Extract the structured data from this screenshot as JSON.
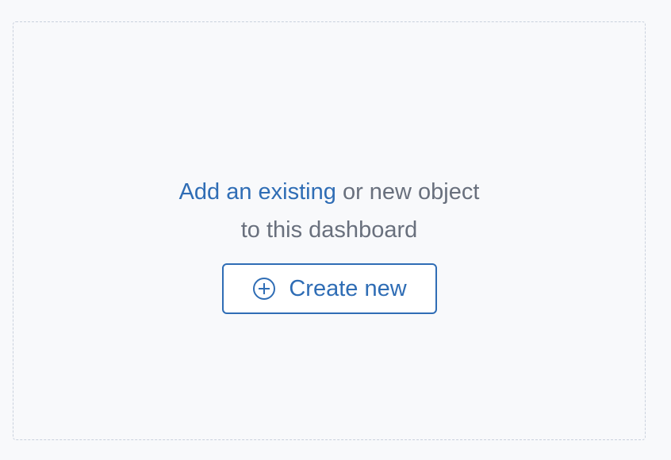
{
  "empty_state": {
    "link_text": "Add an existing",
    "text_rest": "or new object",
    "text_line2": "to this dashboard",
    "create_button_label": "Create new",
    "create_button_icon": "plus-in-circle-icon"
  },
  "colors": {
    "accent": "#2f6db5",
    "muted_text": "#69707d",
    "background": "#f8f9fb",
    "dashed_border": "#c9d1dd"
  }
}
